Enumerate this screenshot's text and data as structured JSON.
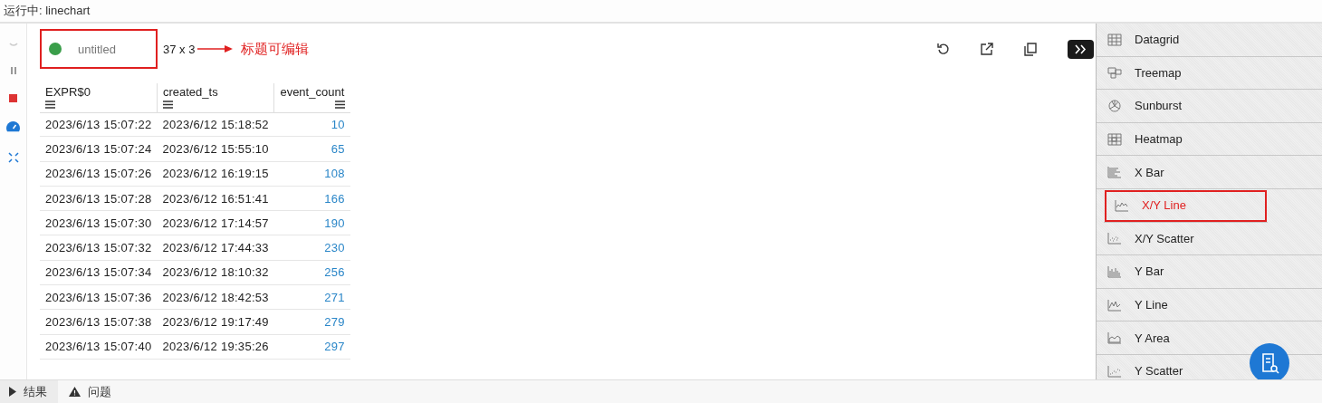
{
  "window": {
    "title": "运行中: linechart"
  },
  "viewer": {
    "title": "untitled",
    "dimensions": "37 x 3",
    "annotation": "标题可编辑"
  },
  "table": {
    "columns": [
      "EXPR$0",
      "created_ts",
      "event_count"
    ],
    "rows": [
      [
        "2023/6/13 15:07:22",
        "2023/6/12 15:18:52",
        "10"
      ],
      [
        "2023/6/13 15:07:24",
        "2023/6/12 15:55:10",
        "65"
      ],
      [
        "2023/6/13 15:07:26",
        "2023/6/12 16:19:15",
        "108"
      ],
      [
        "2023/6/13 15:07:28",
        "2023/6/12 16:51:41",
        "166"
      ],
      [
        "2023/6/13 15:07:30",
        "2023/6/12 17:14:57",
        "190"
      ],
      [
        "2023/6/13 15:07:32",
        "2023/6/12 17:44:33",
        "230"
      ],
      [
        "2023/6/13 15:07:34",
        "2023/6/12 18:10:32",
        "256"
      ],
      [
        "2023/6/13 15:07:36",
        "2023/6/12 18:42:53",
        "271"
      ],
      [
        "2023/6/13 15:07:38",
        "2023/6/12 19:17:49",
        "279"
      ],
      [
        "2023/6/13 15:07:40",
        "2023/6/12 19:35:26",
        "297"
      ]
    ]
  },
  "plugins": [
    {
      "label": "Datagrid",
      "annotated": false
    },
    {
      "label": "Treemap",
      "annotated": false
    },
    {
      "label": "Sunburst",
      "annotated": false
    },
    {
      "label": "Heatmap",
      "annotated": false
    },
    {
      "label": "X Bar",
      "annotated": false
    },
    {
      "label": "X/Y Line",
      "annotated": true
    },
    {
      "label": "X/Y Scatter",
      "annotated": false
    },
    {
      "label": "Y Bar",
      "annotated": false
    },
    {
      "label": "Y Line",
      "annotated": false
    },
    {
      "label": "Y Area",
      "annotated": false
    },
    {
      "label": "Y Scatter",
      "annotated": false
    }
  ],
  "bottom_tabs": [
    {
      "label": "结果",
      "selected": true
    },
    {
      "label": "问题",
      "selected": false
    }
  ]
}
